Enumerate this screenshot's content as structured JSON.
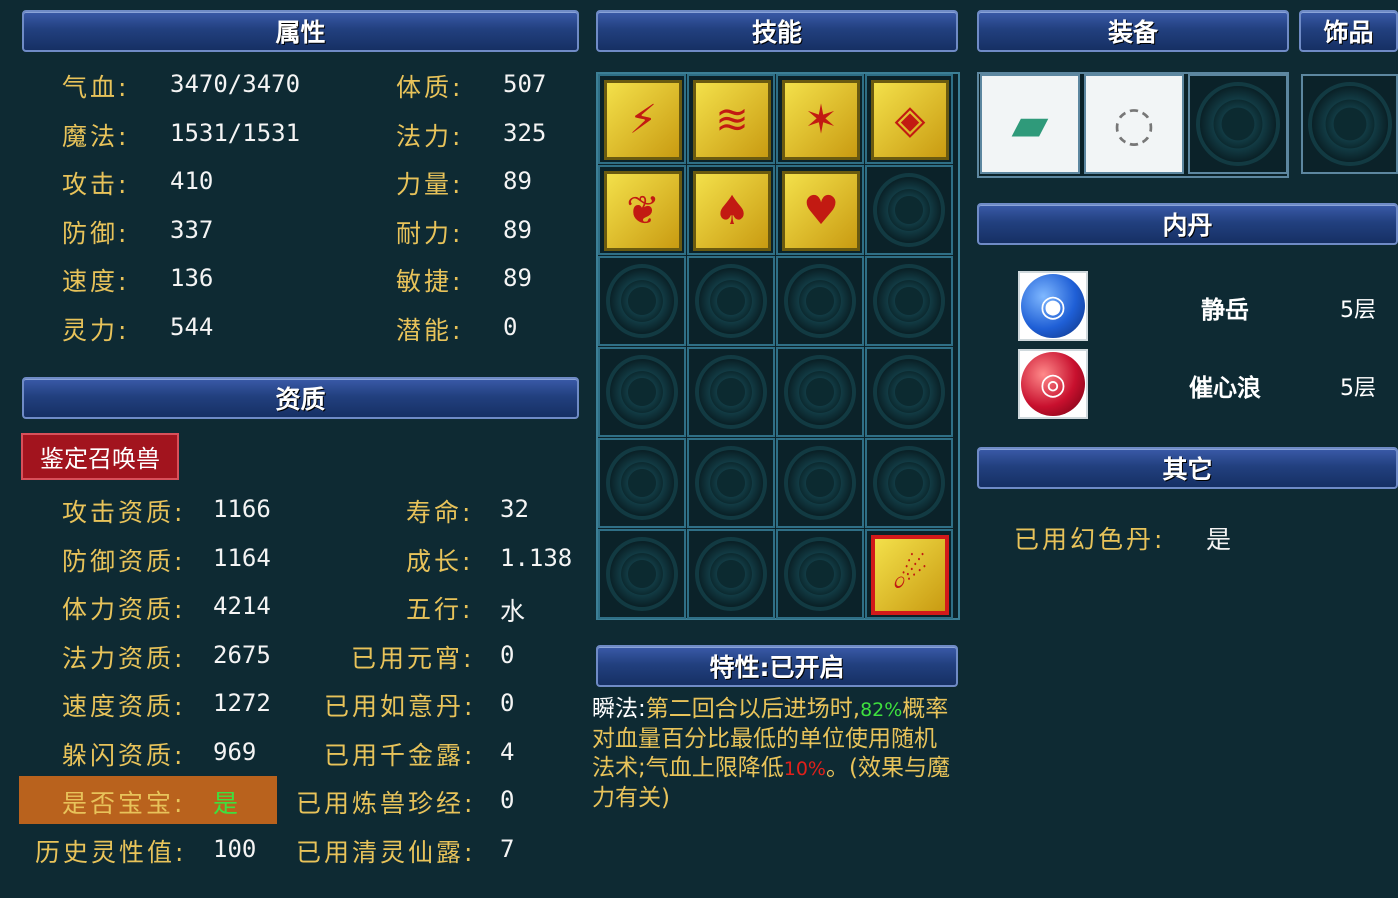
{
  "headers": {
    "attributes": "属性",
    "skills": "技能",
    "equipment": "装备",
    "accessory": "饰品",
    "aptitude": "资质",
    "trait": "特性:已开启",
    "inner_pill": "内丹",
    "other": "其它"
  },
  "attributes": {
    "left": [
      {
        "label": "气血:",
        "value": "3470/3470"
      },
      {
        "label": "魔法:",
        "value": "1531/1531"
      },
      {
        "label": "攻击:",
        "value": "410"
      },
      {
        "label": "防御:",
        "value": "337"
      },
      {
        "label": "速度:",
        "value": "136"
      },
      {
        "label": "灵力:",
        "value": "544"
      }
    ],
    "right": [
      {
        "label": "体质:",
        "value": "507"
      },
      {
        "label": "法力:",
        "value": "325"
      },
      {
        "label": "力量:",
        "value": "89"
      },
      {
        "label": "耐力:",
        "value": "89"
      },
      {
        "label": "敏捷:",
        "value": "89"
      },
      {
        "label": "潜能:",
        "value": "0"
      }
    ]
  },
  "identify_button": "鉴定召唤兽",
  "aptitude": {
    "left": [
      {
        "label": "攻击资质:",
        "value": "1166"
      },
      {
        "label": "防御资质:",
        "value": "1164"
      },
      {
        "label": "体力资质:",
        "value": "4214"
      },
      {
        "label": "法力资质:",
        "value": "2675"
      },
      {
        "label": "速度资质:",
        "value": "1272"
      },
      {
        "label": "躲闪资质:",
        "value": "969"
      },
      {
        "label": "是否宝宝:",
        "value": "是"
      },
      {
        "label": "历史灵性值:",
        "value": "100"
      }
    ],
    "right": [
      {
        "label": "寿命:",
        "value": "32"
      },
      {
        "label": "成长:",
        "value": "1.138"
      },
      {
        "label": "五行:",
        "value": "水"
      },
      {
        "label": "已用元宵:",
        "value": "0"
      },
      {
        "label": "已用如意丹:",
        "value": "0"
      },
      {
        "label": "已用千金露:",
        "value": "4"
      },
      {
        "label": "已用炼兽珍经:",
        "value": "0"
      },
      {
        "label": "已用清灵仙露:",
        "value": "7"
      }
    ]
  },
  "skills": [
    {
      "icon": "lightning-skill-icon",
      "glyph": "⚡"
    },
    {
      "icon": "wave-skill-icon",
      "glyph": "≋"
    },
    {
      "icon": "claw-skill-icon",
      "glyph": "✶"
    },
    {
      "icon": "owl-skill-icon",
      "glyph": "◈"
    },
    {
      "icon": "scroll-skill-icon",
      "glyph": "❦"
    },
    {
      "icon": "figure-skill-icon",
      "glyph": "♠"
    },
    {
      "icon": "heart-skill-icon",
      "glyph": "♥"
    }
  ],
  "special_skill": {
    "icon": "meteor-skill-icon",
    "glyph": "☄"
  },
  "trait_desc": {
    "prefix": "瞬法:",
    "p1": "第二回合以后进场时,",
    "pct1": "82%",
    "p2": "概率对血量百分比最低的单位使用随机法术;气血上限降低",
    "pct2": "10%",
    "p3": "。(效果与魔力有关)"
  },
  "inner_pills": [
    {
      "name": "静岳",
      "level": "5层",
      "color": "#1f5fd6",
      "glyph": "◉"
    },
    {
      "name": "催心浪",
      "level": "5层",
      "color": "#c8102e",
      "glyph": "◎"
    }
  ],
  "other": {
    "label": "已用幻色丹:",
    "value": "是"
  },
  "colors": {
    "accent_gold": "#e8c35a",
    "header_blue": "#22407f",
    "highlight_orange": "#b9621d",
    "button_red": "#a2141e",
    "green_value": "#3ee03e",
    "red_pct": "#e0201a"
  }
}
